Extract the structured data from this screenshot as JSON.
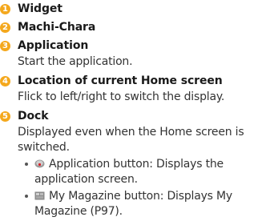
{
  "badge_color": "#f4a81d",
  "items": [
    {
      "num": "1",
      "title": "Widget"
    },
    {
      "num": "2",
      "title": "Machi-Chara"
    },
    {
      "num": "3",
      "title": "Application",
      "desc": [
        "Start the application."
      ]
    },
    {
      "num": "4",
      "title": "Location of current Home screen",
      "desc": [
        "Flick to left/right to switch the display."
      ]
    },
    {
      "num": "5",
      "title": "Dock",
      "desc": [
        "Displayed even when the Home screen is",
        "switched."
      ]
    }
  ],
  "bullets": [
    {
      "icon": "application-button-icon",
      "lines": [
        "Application button: Displays the",
        "application screen."
      ]
    },
    {
      "icon": "my-magazine-button-icon",
      "lines": [
        "My Magazine button: Displays My",
        "Magazine (P97)."
      ]
    }
  ]
}
